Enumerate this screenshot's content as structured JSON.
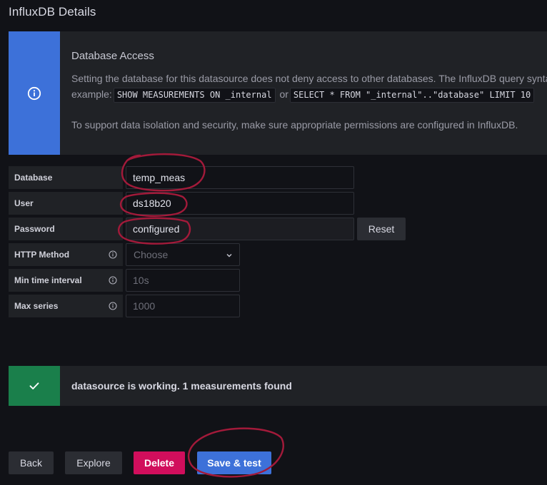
{
  "page": {
    "title": "InfluxDB Details"
  },
  "info": {
    "icon": "info-circle-icon",
    "title": "Database Access",
    "line1": "Setting the database for this datasource does not deny access to other databases. The InfluxDB query syntax allows switching the database in the query. For",
    "line2_prefix": "example:",
    "code1": "SHOW MEASUREMENTS ON _internal",
    "or": "or",
    "code2": "SELECT * FROM \"_internal\"..\"database\" LIMIT 10",
    "line3": "To support data isolation and security, make sure appropriate permissions are configured in InfluxDB.",
    "accent_color": "#3d71d9"
  },
  "form": {
    "database": {
      "label": "Database",
      "value": "temp_meas"
    },
    "user": {
      "label": "User",
      "value": "ds18b20"
    },
    "password": {
      "label": "Password",
      "value": "configured",
      "reset_label": "Reset"
    },
    "http_method": {
      "label": "HTTP Method",
      "value": "Choose",
      "icon": "question-circle-icon"
    },
    "min_time_interval": {
      "label": "Min time interval",
      "placeholder": "10s",
      "icon": "question-circle-icon"
    },
    "max_series": {
      "label": "Max series",
      "placeholder": "1000",
      "icon": "question-circle-icon"
    }
  },
  "alert": {
    "icon": "check-icon",
    "text": "datasource is working. 1 measurements found",
    "color": "#1a7f4b"
  },
  "buttons": {
    "back": "Back",
    "explore": "Explore",
    "delete": "Delete",
    "save_test": "Save & test",
    "delete_color": "#d10e5c",
    "primary_color": "#3d71d9"
  }
}
